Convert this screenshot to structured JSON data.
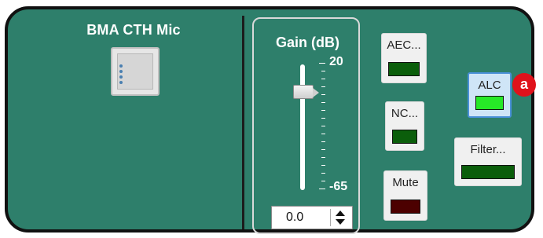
{
  "device": {
    "title": "BMA CTH Mic",
    "icon": "microphone-array-icon"
  },
  "gain": {
    "title": "Gain  (dB)",
    "max_label": "20",
    "min_label": "-65",
    "value": "0.0"
  },
  "controls": {
    "aec": {
      "label": "AEC...",
      "led_color": "#0b5e0b"
    },
    "nc": {
      "label": "NC...",
      "led_color": "#0b5e0b"
    },
    "mute": {
      "label": "Mute",
      "led_color": "#4c0000"
    },
    "alc": {
      "label": "ALC",
      "led_color": "#27e827"
    },
    "filter": {
      "label": "Filter...",
      "led_color": "#0b5e0b"
    }
  },
  "annotation": {
    "badge": "a"
  },
  "colors": {
    "panel_bg": "#2e7f6b",
    "panel_border": "#111111",
    "text": "#ffffff",
    "badge": "#e0121b"
  }
}
